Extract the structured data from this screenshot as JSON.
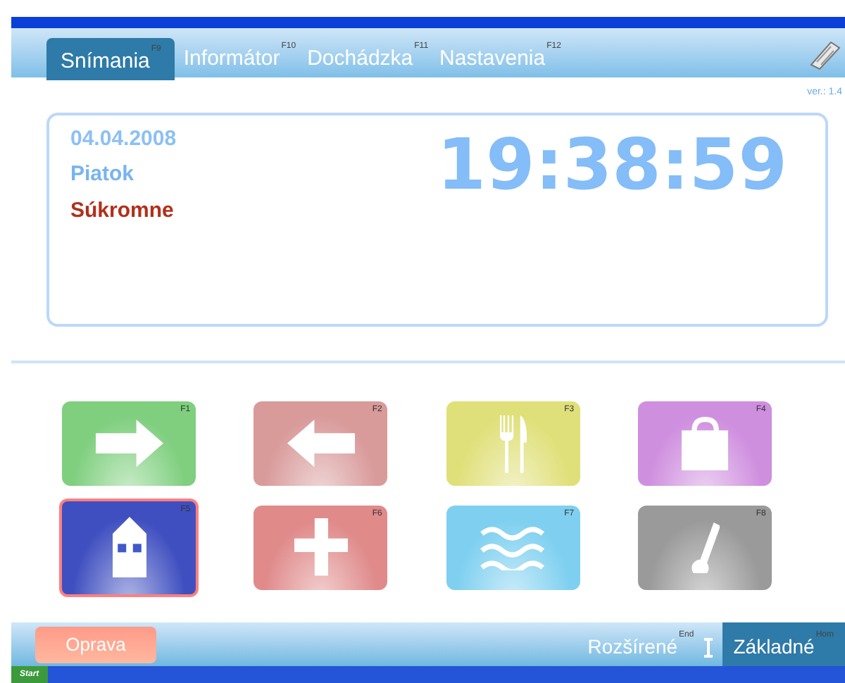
{
  "tabs": [
    {
      "label": "Snímania",
      "key": "F9",
      "selected": true
    },
    {
      "label": "Informátor",
      "key": "F10",
      "selected": false
    },
    {
      "label": "Dochádzka",
      "key": "F11",
      "selected": false
    },
    {
      "label": "Nastavenia",
      "key": "F12",
      "selected": false
    }
  ],
  "version": "ver.: 1.4",
  "info": {
    "date": "04.04.2008",
    "day": "Piatok",
    "mode": "Súkromne",
    "time": "19:38:59"
  },
  "keys": [
    {
      "key": "F1",
      "kind": "arrow-right",
      "color": "#7fcf7f",
      "selected": false
    },
    {
      "key": "F2",
      "kind": "arrow-left",
      "color": "#d99a9a",
      "selected": false
    },
    {
      "key": "F3",
      "kind": "cutlery",
      "color": "#e0e07a",
      "selected": false
    },
    {
      "key": "F4",
      "kind": "bag",
      "color": "#cf8fdf",
      "selected": false
    },
    {
      "key": "F5",
      "kind": "house",
      "color": "#3f4fc0",
      "selected": true
    },
    {
      "key": "F6",
      "kind": "cross",
      "color": "#e08a8a",
      "selected": false
    },
    {
      "key": "F7",
      "kind": "waves",
      "color": "#7fd0f0",
      "selected": false
    },
    {
      "key": "F8",
      "kind": "thermometer",
      "color": "#9a9a9a",
      "selected": false
    }
  ],
  "bottom": {
    "left_button": "Oprava",
    "tabs": [
      {
        "label": "Rozšírené",
        "key": "End",
        "selected": false
      },
      {
        "label": "Základné",
        "key": "Hom",
        "selected": true
      }
    ]
  },
  "taskbar": {
    "start": "Start"
  }
}
